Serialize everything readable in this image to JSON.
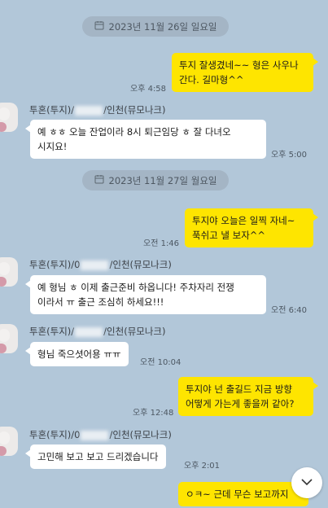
{
  "dates": [
    {
      "label": "2023년 11월 26일 일요일"
    },
    {
      "label": "2023년 11월 27일 월요일"
    }
  ],
  "messages": [
    {
      "from": "me",
      "text": "투지 잘생겼네~~ 형은 사우나\n간다. 길마형^^",
      "time": "오후 4:58"
    },
    {
      "from": "other",
      "sender_prefix": "투혼(투지)/",
      "sender_suffix": "/인천(뮤모나크)",
      "text": "예 ㅎㅎ 오늘 잔업이라 8시 퇴근임당 ㅎ 잘 다녀오\n시지요!",
      "time": "오후 5:00"
    },
    {
      "from": "me",
      "text": "투지야 오늘은 일찍 자네~\n푹쉬고 낼 보자^^",
      "time": "오전 1:46"
    },
    {
      "from": "other",
      "sender_prefix": "투혼(투지)/0",
      "sender_suffix": "/인천(뮤모나크)",
      "text": "예 형님 ㅎ 이제 출근준비 하옵니다! 주차자리 전쟁\n이라서 ㅠ 출근 조심히 하세요!!!",
      "time": "오전 6:40"
    },
    {
      "from": "other",
      "sender_prefix": "투혼(투지)/",
      "sender_suffix": "/인천(뮤모나크)",
      "text": "형님 죽으셧어용 ㅠㅠ",
      "time": "오전 10:04"
    },
    {
      "from": "me",
      "text": "투지야 넌 출길드 지금 방향\n어떻게 가는게 좋을꺼 같아?",
      "time": "오후 12:48"
    },
    {
      "from": "other",
      "sender_prefix": "투혼(투지)/0",
      "sender_suffix": "/인천(뮤모나크)",
      "text": "고민해 보고 보고 드리겠습니다",
      "time": "오후 2:01"
    },
    {
      "from": "me",
      "text": "ㅇㅋ~ 근데 무슨 보고까지"
    }
  ],
  "icons": {
    "date": "calendar-icon",
    "scroll": "chevron-down-icon"
  }
}
